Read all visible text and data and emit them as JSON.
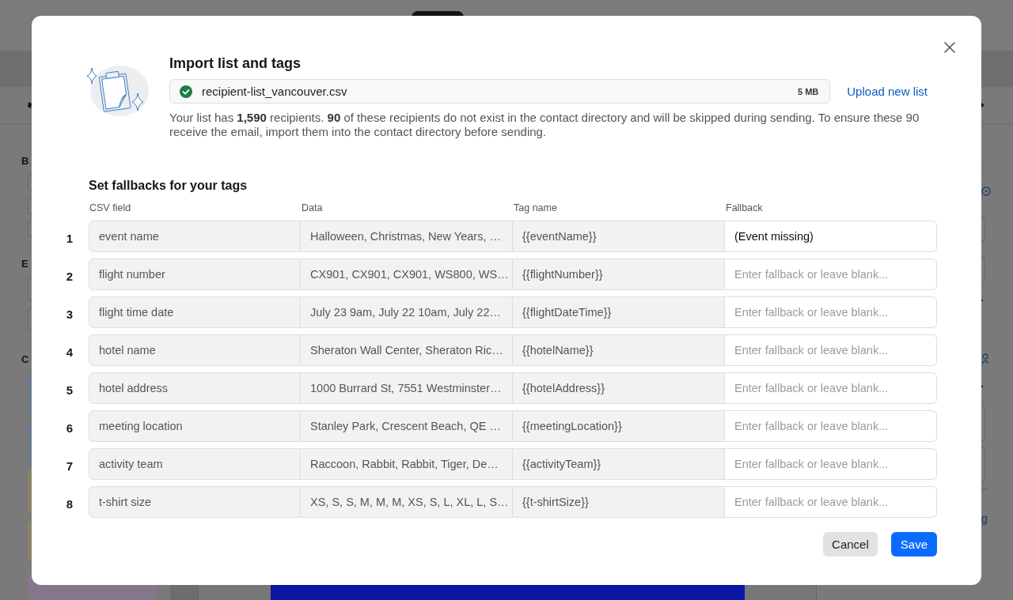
{
  "background_page": {
    "section_labels": [
      "B",
      "E",
      "C"
    ],
    "panel_link": "g"
  },
  "import_dialog": {
    "title": "Import list and tags",
    "file_name": "recipient-list_vancouver.csv",
    "file_size": "5 MB",
    "upload_link": "Upload new list",
    "summary": "Your list has **1,590** recipients. **90** of these recipients do not exist in the contact directory and will be skipped during sending. To ensure these 90 receive the email, import them into the contact directory before sending."
  },
  "fallbacks": {
    "title": "Set fallbacks for your tags",
    "columns": [
      "CSV field",
      "Data",
      "Tag name",
      "Fallback"
    ],
    "rows": [
      {
        "number": "1",
        "csv_field": "event name",
        "data": "Halloween, Christmas, New Years, …",
        "tag_name": "{{eventName}}",
        "fallback": {
          "value": "(Event missing)"
        }
      },
      {
        "number": "2",
        "csv_field": "flight number",
        "data": "CX901, CX901, CX901, WS800, WS…",
        "tag_name": "{{flightNumber}}",
        "fallback": {
          "placeholder": "Enter fallback or leave blank..."
        }
      },
      {
        "number": "3",
        "csv_field": "flight time date",
        "data": "July 23 9am, July 22 10am, July 22…",
        "tag_name": "{{flightDateTime}}",
        "fallback": {
          "placeholder": "Enter fallback or leave blank..."
        }
      },
      {
        "number": "4",
        "csv_field": "hotel name",
        "data": "Sheraton Wall Center, Sheraton Ric…",
        "tag_name": "{{hotelName}}",
        "fallback": {
          "placeholder": "Enter fallback or leave blank..."
        }
      },
      {
        "number": "5",
        "csv_field": "hotel address",
        "data": "1000 Burrard St, 7551 Westminster…",
        "tag_name": "{{hotelAddress}}",
        "fallback": {
          "placeholder": "Enter fallback or leave blank..."
        }
      },
      {
        "number": "6",
        "csv_field": "meeting location",
        "data": "Stanley Park, Crescent Beach, QE …",
        "tag_name": "{{meetingLocation}}",
        "fallback": {
          "placeholder": "Enter fallback or leave blank..."
        }
      },
      {
        "number": "7",
        "csv_field": "activity team",
        "data": "Raccoon, Rabbit, Rabbit, Tiger, De…",
        "tag_name": "{{activityTeam}}",
        "fallback": {
          "placeholder": "Enter fallback or leave blank..."
        }
      },
      {
        "number": "8",
        "csv_field": "t-shirt size",
        "data": "XS, S, S, M, M, M, XS, S, L, XL, L, S…",
        "tag_name": "{{t-shirtSize}}",
        "fallback": {
          "placeholder": "Enter fallback or leave blank..."
        }
      }
    ]
  },
  "buttons": [
    {
      "label": "Cancel",
      "kind": "secondary"
    },
    {
      "label": "Save",
      "kind": "primary"
    }
  ]
}
